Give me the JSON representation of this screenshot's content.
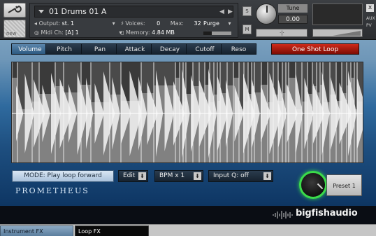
{
  "header": {
    "instrument_name": "01 Drums 01 A",
    "output_label": "Output:",
    "output_value": "st. 1",
    "voices_label": "Voices:",
    "voices_value": "0",
    "max_label": "Max:",
    "max_value": "32",
    "purge_label": "Purge",
    "midi_label": "Midi Ch:",
    "midi_value": "[A] 1",
    "memory_label": "Memory:",
    "memory_value": "4.84 MB",
    "new_label": "new",
    "s_label": "S",
    "m_label": "M",
    "tune_label": "Tune",
    "tune_value": "0.00",
    "pan_glyph": "·|·",
    "close_glyph": "x",
    "aux_label": "AUX",
    "pv_label": "PV"
  },
  "param_tabs": [
    {
      "label": "Volume",
      "active": true
    },
    {
      "label": "Pitch",
      "active": false
    },
    {
      "label": "Pan",
      "active": false
    },
    {
      "label": "Attack",
      "active": false
    },
    {
      "label": "Decay",
      "active": false
    },
    {
      "label": "Cutoff",
      "active": false
    },
    {
      "label": "Reso",
      "active": false
    }
  ],
  "one_shot_label": "One Shot Loop",
  "controls": {
    "mode_label": "MODE: Play loop forward",
    "edit_label": "Edit",
    "bpm_label": "BPM x 1",
    "inputq_label": "Input Q: off",
    "dropdown_arrow": "⬇"
  },
  "brand_logo": "PROMETHEUS",
  "preset_label": "Preset 1",
  "footer_brand": "bigfishaudio",
  "bottom_tabs": [
    {
      "label": "Instrument FX",
      "active": false
    },
    {
      "label": "Loop FX",
      "active": true
    }
  ],
  "colors": {
    "accent_red": "#cf2a1a",
    "preset_ring": "#3bdc4a",
    "active_tab": "#5b86ab"
  }
}
